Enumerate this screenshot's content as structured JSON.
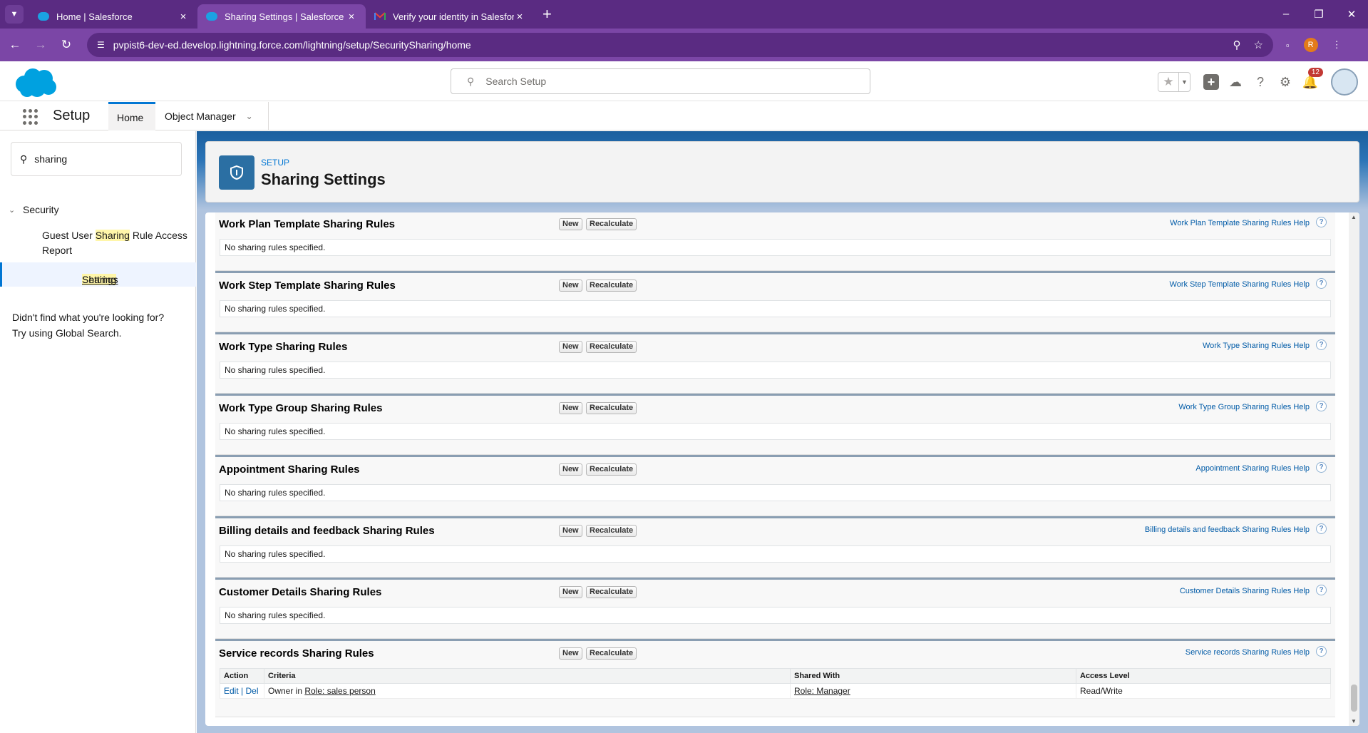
{
  "browser": {
    "tabs": [
      {
        "title": "Home | Salesforce",
        "icon": "salesforce-cloud-icon"
      },
      {
        "title": "Sharing Settings | Salesforce",
        "icon": "salesforce-cloud-icon"
      },
      {
        "title": "Verify your identity in Salesforce",
        "icon": "gmail-icon"
      }
    ],
    "url": "pvpist6-dev-ed.develop.lightning.force.com/lightning/setup/SecuritySharing/home",
    "profile_initial": "R"
  },
  "header": {
    "search_placeholder": "Search Setup",
    "notification_count": "12"
  },
  "setup_nav": {
    "app_name": "Setup",
    "tabs": [
      "Home",
      "Object Manager"
    ]
  },
  "sidebar": {
    "quickfind_value": "sharing",
    "group": "Security",
    "item1_pre": "Guest User ",
    "item1_hl": "Sharing",
    "item1_post": " Rule Access Report",
    "item2_hl": "Sharing",
    "item2_post": " Settings",
    "notfound_line1": "Didn't find what you're looking for?",
    "notfound_line2": "Try using Global Search."
  },
  "page": {
    "breadcrumb": "SETUP",
    "title": "Sharing Settings"
  },
  "buttons": {
    "new": "New",
    "recalculate": "Recalculate"
  },
  "empty_text": "No sharing rules specified.",
  "sections": [
    {
      "title": "Work Plan Template Sharing Rules",
      "help": "Work Plan Template Sharing Rules Help"
    },
    {
      "title": "Work Step Template Sharing Rules",
      "help": "Work Step Template Sharing Rules Help"
    },
    {
      "title": "Work Type Sharing Rules",
      "help": "Work Type Sharing Rules Help"
    },
    {
      "title": "Work Type Group Sharing Rules",
      "help": "Work Type Group Sharing Rules Help"
    },
    {
      "title": "Appointment Sharing Rules",
      "help": "Appointment Sharing Rules Help"
    },
    {
      "title": "Billing details and feedback Sharing Rules",
      "help": "Billing details and feedback Sharing Rules Help"
    },
    {
      "title": "Customer Details Sharing Rules",
      "help": "Customer Details Sharing Rules Help"
    },
    {
      "title": "Service records Sharing Rules",
      "help": "Service records Sharing Rules Help"
    }
  ],
  "rules_table": {
    "headers": [
      "Action",
      "Criteria",
      "Shared With",
      "Access Level"
    ],
    "row": {
      "edit": "Edit",
      "sep": " | ",
      "del": "Del",
      "criteria_prefix": "Owner in ",
      "criteria_link": "Role: sales person",
      "shared_with": "Role: Manager",
      "access": "Read/Write"
    }
  },
  "colors": {
    "brand": "#0176d3",
    "browser": "#7b46a6"
  }
}
